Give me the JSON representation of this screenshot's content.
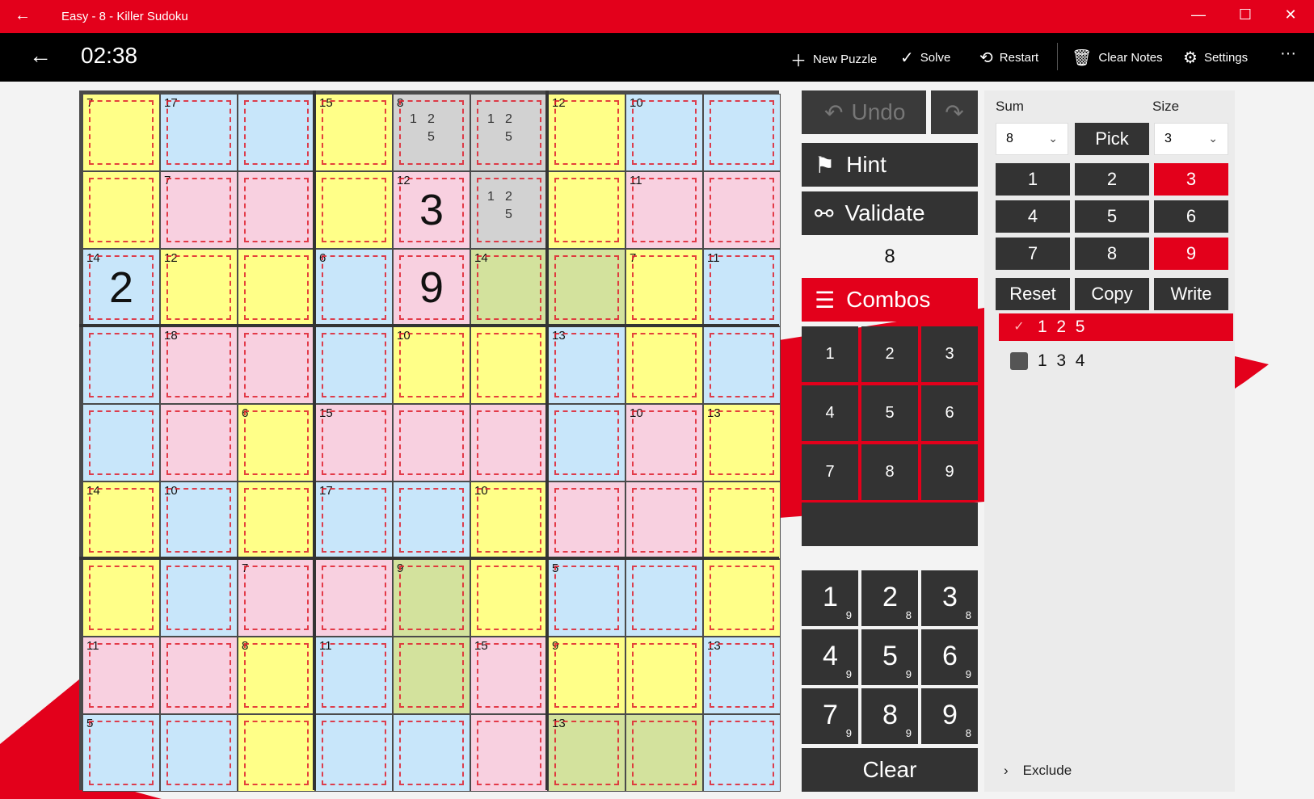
{
  "window": {
    "title": "Easy - 8 - Killer Sudoku",
    "back_glyph": "←",
    "minimize": "—",
    "maximize": "☐",
    "close": "✕"
  },
  "toolbar": {
    "timer": "02:38",
    "new_puzzle": "New Puzzle",
    "solve": "Solve",
    "restart": "Restart",
    "clear_notes": "Clear Notes",
    "settings": "Settings",
    "more": "···"
  },
  "colors": {
    "yellow": "#ffff88",
    "blue": "#c8e6fa",
    "pink": "#f8d0e0",
    "green": "#d3e29d",
    "gray": "#d2d2d2",
    "accent": "#e3001b",
    "cage_border": "#e0202e"
  },
  "grid": {
    "colors": [
      [
        "Y",
        "B",
        "B",
        "Y",
        "G",
        "G",
        "Y",
        "B",
        "B"
      ],
      [
        "Y",
        "P",
        "P",
        "Y",
        "P",
        "G",
        "Y",
        "P",
        "P"
      ],
      [
        "B",
        "Y",
        "Y",
        "B",
        "P",
        "V",
        "V",
        "Y",
        "B"
      ],
      [
        "B",
        "P",
        "P",
        "B",
        "Y",
        "Y",
        "B",
        "Y",
        "B"
      ],
      [
        "B",
        "P",
        "Y",
        "P",
        "P",
        "P",
        "B",
        "P",
        "Y"
      ],
      [
        "Y",
        "B",
        "Y",
        "B",
        "B",
        "Y",
        "P",
        "P",
        "Y"
      ],
      [
        "Y",
        "B",
        "P",
        "P",
        "V",
        "Y",
        "B",
        "B",
        "Y"
      ],
      [
        "P",
        "P",
        "Y",
        "B",
        "V",
        "P",
        "Y",
        "Y",
        "B"
      ],
      [
        "B",
        "B",
        "Y",
        "B",
        "B",
        "P",
        "V",
        "V",
        "B"
      ]
    ],
    "cage_sums": [
      {
        "r": 0,
        "c": 0,
        "sum": "7"
      },
      {
        "r": 0,
        "c": 1,
        "sum": "17"
      },
      {
        "r": 0,
        "c": 3,
        "sum": "15"
      },
      {
        "r": 0,
        "c": 4,
        "sum": "8"
      },
      {
        "r": 0,
        "c": 6,
        "sum": "12"
      },
      {
        "r": 0,
        "c": 7,
        "sum": "10"
      },
      {
        "r": 1,
        "c": 1,
        "sum": "7"
      },
      {
        "r": 1,
        "c": 4,
        "sum": "12"
      },
      {
        "r": 1,
        "c": 7,
        "sum": "11"
      },
      {
        "r": 2,
        "c": 0,
        "sum": "14"
      },
      {
        "r": 2,
        "c": 1,
        "sum": "12"
      },
      {
        "r": 2,
        "c": 3,
        "sum": "6"
      },
      {
        "r": 2,
        "c": 5,
        "sum": "14"
      },
      {
        "r": 2,
        "c": 7,
        "sum": "7"
      },
      {
        "r": 2,
        "c": 8,
        "sum": "11"
      },
      {
        "r": 3,
        "c": 1,
        "sum": "18"
      },
      {
        "r": 3,
        "c": 4,
        "sum": "10"
      },
      {
        "r": 3,
        "c": 6,
        "sum": "13"
      },
      {
        "r": 4,
        "c": 2,
        "sum": "6"
      },
      {
        "r": 4,
        "c": 3,
        "sum": "15"
      },
      {
        "r": 4,
        "c": 7,
        "sum": "10"
      },
      {
        "r": 4,
        "c": 8,
        "sum": "13"
      },
      {
        "r": 5,
        "c": 0,
        "sum": "14"
      },
      {
        "r": 5,
        "c": 1,
        "sum": "10"
      },
      {
        "r": 5,
        "c": 3,
        "sum": "17"
      },
      {
        "r": 5,
        "c": 5,
        "sum": "10"
      },
      {
        "r": 6,
        "c": 2,
        "sum": "7"
      },
      {
        "r": 6,
        "c": 4,
        "sum": "9"
      },
      {
        "r": 6,
        "c": 6,
        "sum": "5"
      },
      {
        "r": 7,
        "c": 0,
        "sum": "11"
      },
      {
        "r": 7,
        "c": 2,
        "sum": "8"
      },
      {
        "r": 7,
        "c": 3,
        "sum": "11"
      },
      {
        "r": 7,
        "c": 5,
        "sum": "15"
      },
      {
        "r": 7,
        "c": 6,
        "sum": "9"
      },
      {
        "r": 7,
        "c": 8,
        "sum": "13"
      },
      {
        "r": 8,
        "c": 0,
        "sum": "5"
      },
      {
        "r": 8,
        "c": 6,
        "sum": "13"
      }
    ],
    "values": [
      {
        "r": 1,
        "c": 4,
        "v": "3"
      },
      {
        "r": 2,
        "c": 0,
        "v": "2"
      },
      {
        "r": 2,
        "c": 4,
        "v": "9"
      }
    ],
    "notes": [
      {
        "r": 0,
        "c": 4,
        "n": [
          "1",
          "2",
          "5"
        ]
      },
      {
        "r": 0,
        "c": 5,
        "n": [
          "1",
          "2",
          "5"
        ]
      },
      {
        "r": 1,
        "c": 5,
        "n": [
          "1",
          "2",
          "5"
        ]
      }
    ]
  },
  "controls": {
    "undo": "Undo",
    "redo_glyph": "↷",
    "hint": "Hint",
    "validate": "Validate",
    "cage_sum_display": "8",
    "combos": "Combos",
    "combo_keys": [
      "1",
      "2",
      "3",
      "4",
      "5",
      "6",
      "7",
      "8",
      "9"
    ],
    "number_keys": [
      {
        "d": "1",
        "c": "9"
      },
      {
        "d": "2",
        "c": "8"
      },
      {
        "d": "3",
        "c": "8"
      },
      {
        "d": "4",
        "c": "9"
      },
      {
        "d": "5",
        "c": "9"
      },
      {
        "d": "6",
        "c": "9"
      },
      {
        "d": "7",
        "c": "9"
      },
      {
        "d": "8",
        "c": "9"
      },
      {
        "d": "9",
        "c": "8"
      }
    ],
    "clear": "Clear"
  },
  "combo_panel": {
    "sum_label": "Sum",
    "size_label": "Size",
    "sum_value": "8",
    "pick": "Pick",
    "size_value": "3",
    "digits": [
      {
        "d": "1",
        "on": false
      },
      {
        "d": "2",
        "on": false
      },
      {
        "d": "3",
        "on": true
      },
      {
        "d": "4",
        "on": false
      },
      {
        "d": "5",
        "on": false
      },
      {
        "d": "6",
        "on": false
      },
      {
        "d": "7",
        "on": false
      },
      {
        "d": "8",
        "on": false
      },
      {
        "d": "9",
        "on": true
      }
    ],
    "reset": "Reset",
    "copy": "Copy",
    "write": "Write",
    "combos": [
      {
        "text": "1  2  5",
        "selected": true
      },
      {
        "text": "1  3  4",
        "selected": false
      }
    ],
    "exclude": "Exclude"
  }
}
